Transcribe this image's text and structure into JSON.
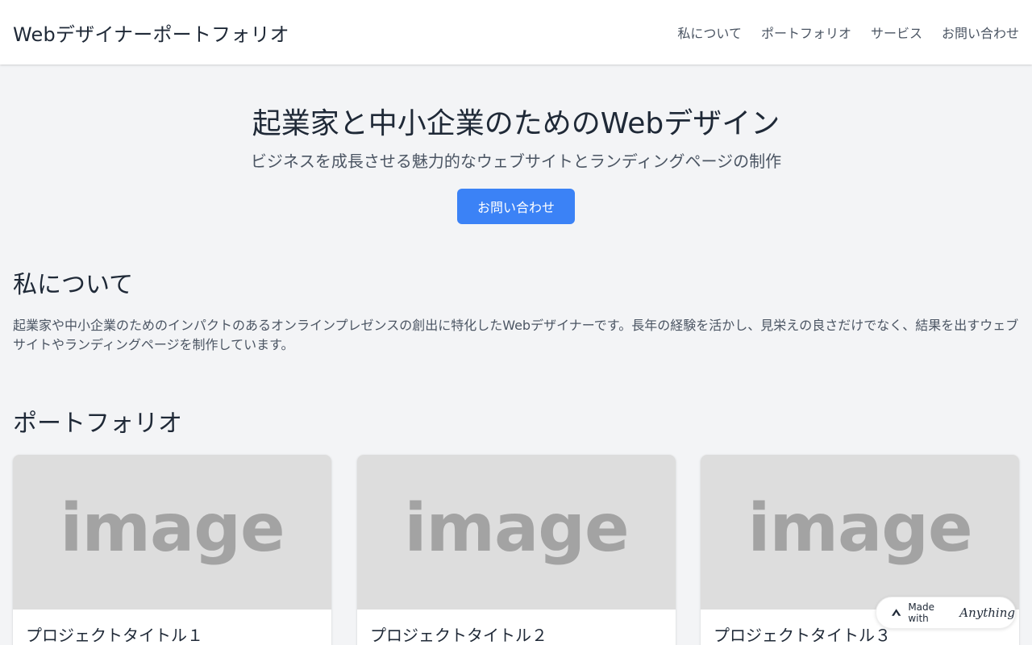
{
  "header": {
    "site_title": "Webデザイナーポートフォリオ",
    "nav": [
      {
        "label": "私について"
      },
      {
        "label": "ポートフォリオ"
      },
      {
        "label": "サービス"
      },
      {
        "label": "お問い合わせ"
      }
    ]
  },
  "hero": {
    "title": "起業家と中小企業のためのWebデザイン",
    "subtitle": "ビジネスを成長させる魅力的なウェブサイトとランディングページの制作",
    "cta_label": "お問い合わせ"
  },
  "about": {
    "heading": "私について",
    "text": "起業家や中小企業のためのインパクトのあるオンラインプレゼンスの創出に特化したWebデザイナーです。長年の経験を活かし、見栄えの良さだけでなく、結果を出すウェブサイトやランディングページを制作しています。"
  },
  "portfolio": {
    "heading": "ポートフォリオ",
    "projects": [
      {
        "image_text": "image",
        "title": "プロジェクトタイトル１"
      },
      {
        "image_text": "image",
        "title": "プロジェクトタイトル２"
      },
      {
        "image_text": "image",
        "title": "プロジェクトタイトル３"
      }
    ]
  },
  "badge": {
    "made_with": "Made with",
    "brand": "Anything"
  },
  "colors": {
    "accent": "#3b82f6",
    "background": "#f3f4f6",
    "text_primary": "#1f2937",
    "text_secondary": "#4b5563",
    "placeholder": "#dddddd"
  }
}
